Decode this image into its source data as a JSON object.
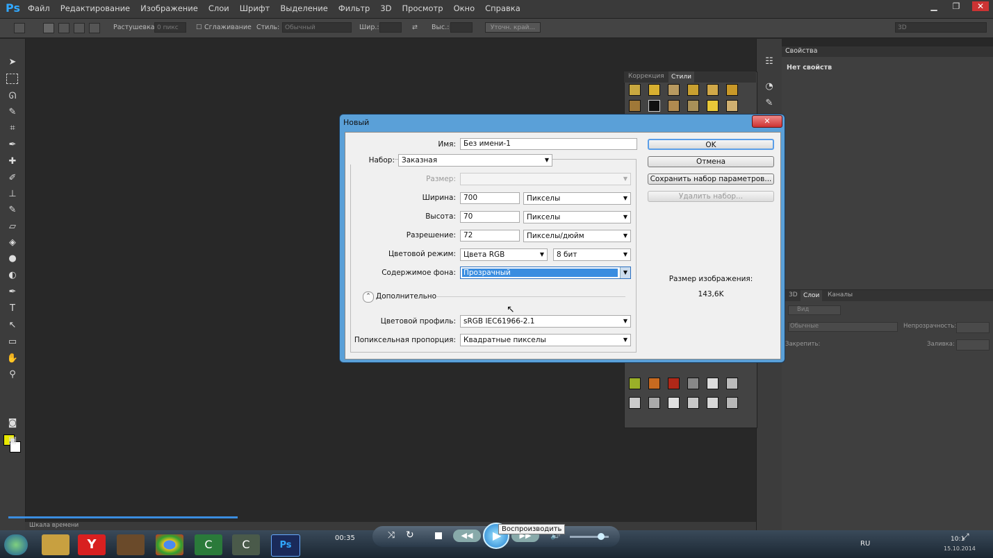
{
  "app": {
    "logo": "Ps"
  },
  "menu": [
    "Файл",
    "Редактирование",
    "Изображение",
    "Слои",
    "Шрифт",
    "Выделение",
    "Фильтр",
    "3D",
    "Просмотр",
    "Окно",
    "Справка"
  ],
  "options_bar": {
    "feather_label": "Растушевка:",
    "feather_value": "0 пикс",
    "antialias_label": "Сглаживание",
    "style_label": "Стиль:",
    "style_value": "Обычный",
    "width_label": "Шир.:",
    "height_label": "Выс.:",
    "refine_edge": "Уточн. край...",
    "workspace": "3D"
  },
  "properties_panel": {
    "tab": "Свойства",
    "content": "Нет свойств"
  },
  "styles_panel": {
    "tabs": [
      "Коррекция",
      "Стили"
    ]
  },
  "layers_panel": {
    "tabs": [
      "3D",
      "Слои",
      "Каналы"
    ],
    "filter": "Вид",
    "blend_mode": "Обычные",
    "opacity_label": "Непрозрачность:",
    "lock_label": "Закрепить:",
    "fill_label": "Заливка:"
  },
  "timeline": {
    "label": "Шкала времени"
  },
  "dialog": {
    "title": "Новый",
    "name_label": "Имя:",
    "name_value": "Без имени-1",
    "preset_label": "Набор:",
    "preset_value": "Заказная",
    "size_label": "Размер:",
    "width_label": "Ширина:",
    "width_value": "700",
    "width_unit": "Пикселы",
    "height_label": "Высота:",
    "height_value": "70",
    "height_unit": "Пикселы",
    "resolution_label": "Разрешение:",
    "resolution_value": "72",
    "resolution_unit": "Пикселы/дюйм",
    "color_mode_label": "Цветовой режим:",
    "color_mode_value": "Цвета RGB",
    "bit_depth": "8 бит",
    "bg_label": "Содержимое фона:",
    "bg_value": "Прозрачный",
    "advanced_label": "Дополнительно",
    "profile_label": "Цветовой профиль:",
    "profile_value": "sRGB IEC61966-2.1",
    "pixel_aspect_label": "Попиксельная пропорция:",
    "pixel_aspect_value": "Квадратные пикселы",
    "buttons": {
      "ok": "OK",
      "cancel": "Отмена",
      "save_preset": "Сохранить набор параметров...",
      "delete_preset": "Удалить набор..."
    },
    "image_size_label": "Размер изображения:",
    "image_size_value": "143,6K"
  },
  "media_player": {
    "time": "00:35",
    "tooltip": "Воспроизводить"
  },
  "taskbar": {
    "lang": "RU",
    "clock": "10:1",
    "date": "15.10.2014"
  }
}
